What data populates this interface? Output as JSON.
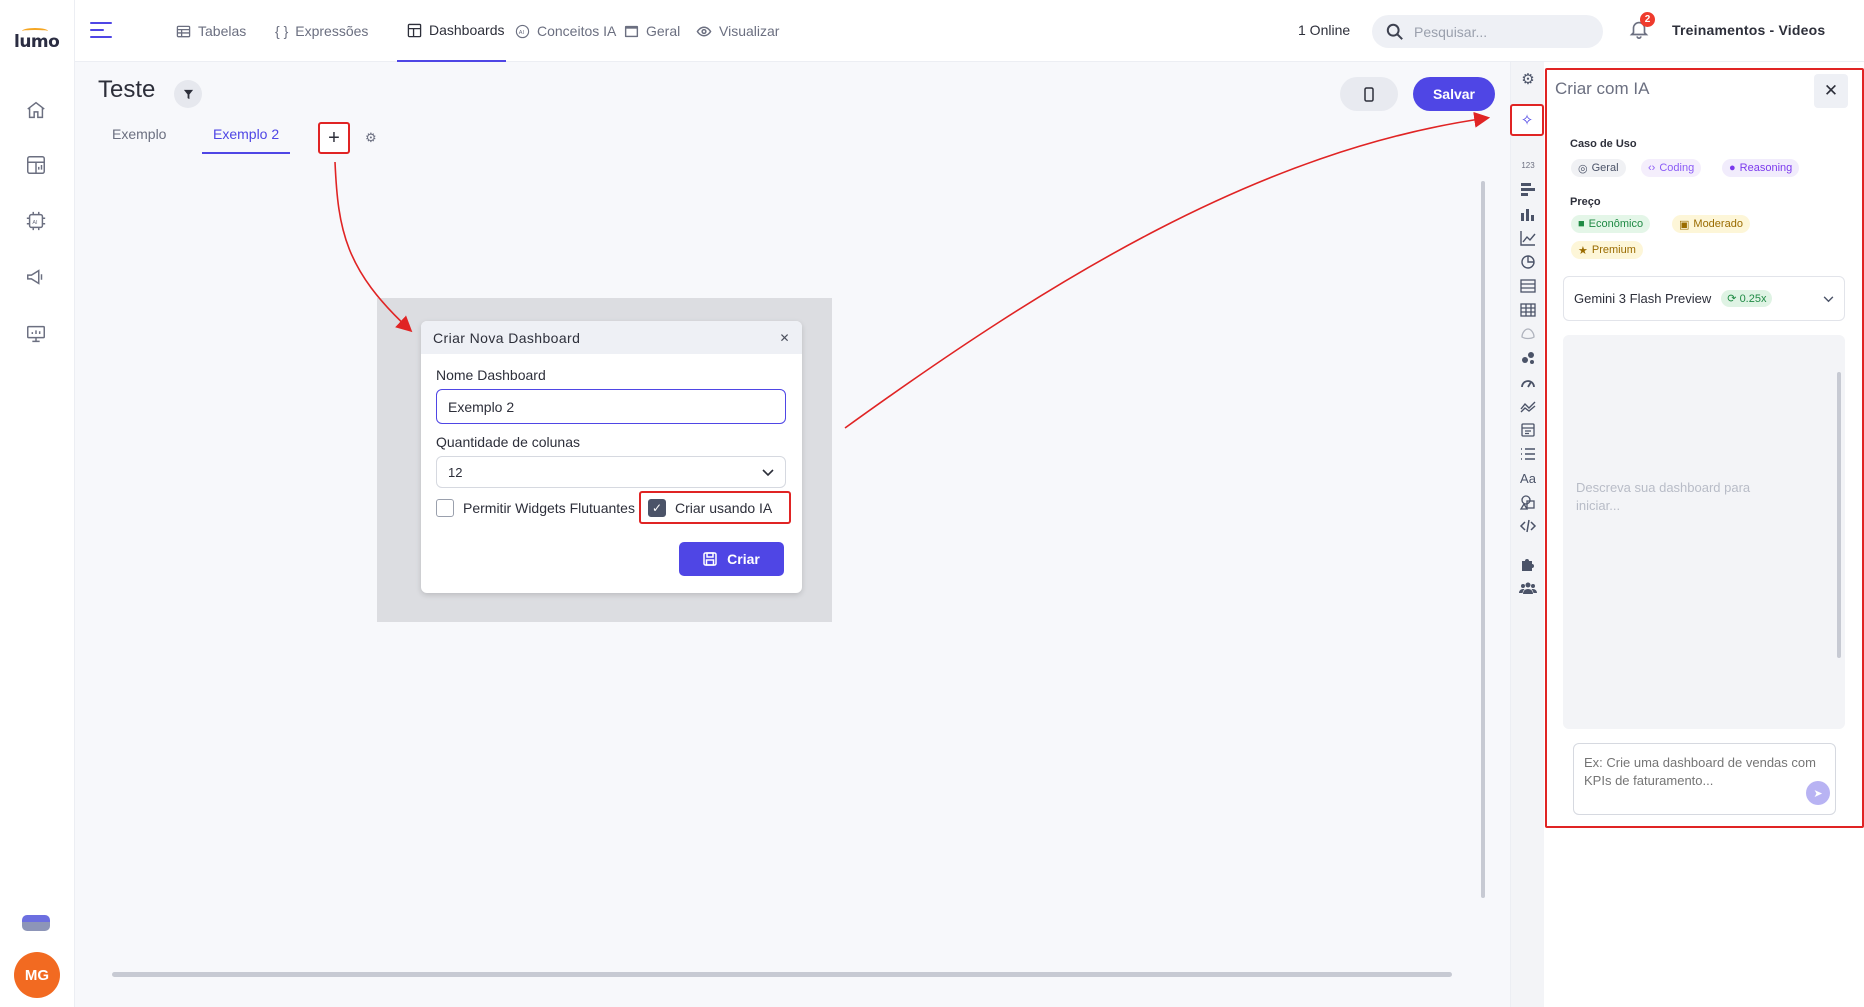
{
  "app": {
    "logo": "lumo"
  },
  "sidebar": {
    "items": [
      {
        "icon": "home-icon"
      },
      {
        "icon": "dashboard-icon"
      },
      {
        "icon": "ai-chip-icon"
      },
      {
        "icon": "megaphone-icon"
      },
      {
        "icon": "presentation-icon"
      }
    ],
    "user_initials": "MG"
  },
  "topnav": {
    "tabs": [
      {
        "label": "Tabelas",
        "icon": "table-icon"
      },
      {
        "label": "Expressões",
        "icon": "braces-icon"
      },
      {
        "label": "Dashboards",
        "icon": "dashboard-icon"
      },
      {
        "label": "Conceitos IA",
        "icon": "ai-icon"
      },
      {
        "label": "Geral",
        "icon": "window-icon"
      },
      {
        "label": "Visualizar",
        "icon": "eye-icon"
      }
    ],
    "active_tab": "Dashboards",
    "online": "1 Online",
    "search_placeholder": "Pesquisar...",
    "notification_count": "2",
    "workspace": "Treinamentos - Videos"
  },
  "page": {
    "title": "Teste",
    "tabs": [
      "Exemplo",
      "Exemplo 2"
    ],
    "active_tab": "Exemplo 2",
    "save_label": "Salvar"
  },
  "dialog": {
    "title": "Criar Nova Dashboard",
    "name_label": "Nome Dashboard",
    "name_value": "Exemplo 2",
    "columns_label": "Quantidade de colunas",
    "columns_value": "12",
    "floating_label": "Permitir Widgets Flutuantes",
    "floating_checked": false,
    "ai_label": "Criar usando IA",
    "ai_checked": true,
    "create_label": "Criar"
  },
  "ai_panel": {
    "title": "Criar com IA",
    "use_case_label": "Caso de Uso",
    "use_cases": [
      "Geral",
      "Coding",
      "Reasoning"
    ],
    "price_label": "Preço",
    "prices": [
      "Econômico",
      "Moderado",
      "Premium"
    ],
    "model": "Gemini 3 Flash Preview",
    "model_cost": "0.25x",
    "chat_placeholder": "Descreva sua dashboard para iniciar...",
    "prompt_placeholder": "Ex: Crie uma dashboard de vendas com KPIs de faturamento..."
  },
  "colors": {
    "accent": "#4f46e5",
    "highlight": "#e02424",
    "avatar": "#f26a21"
  }
}
